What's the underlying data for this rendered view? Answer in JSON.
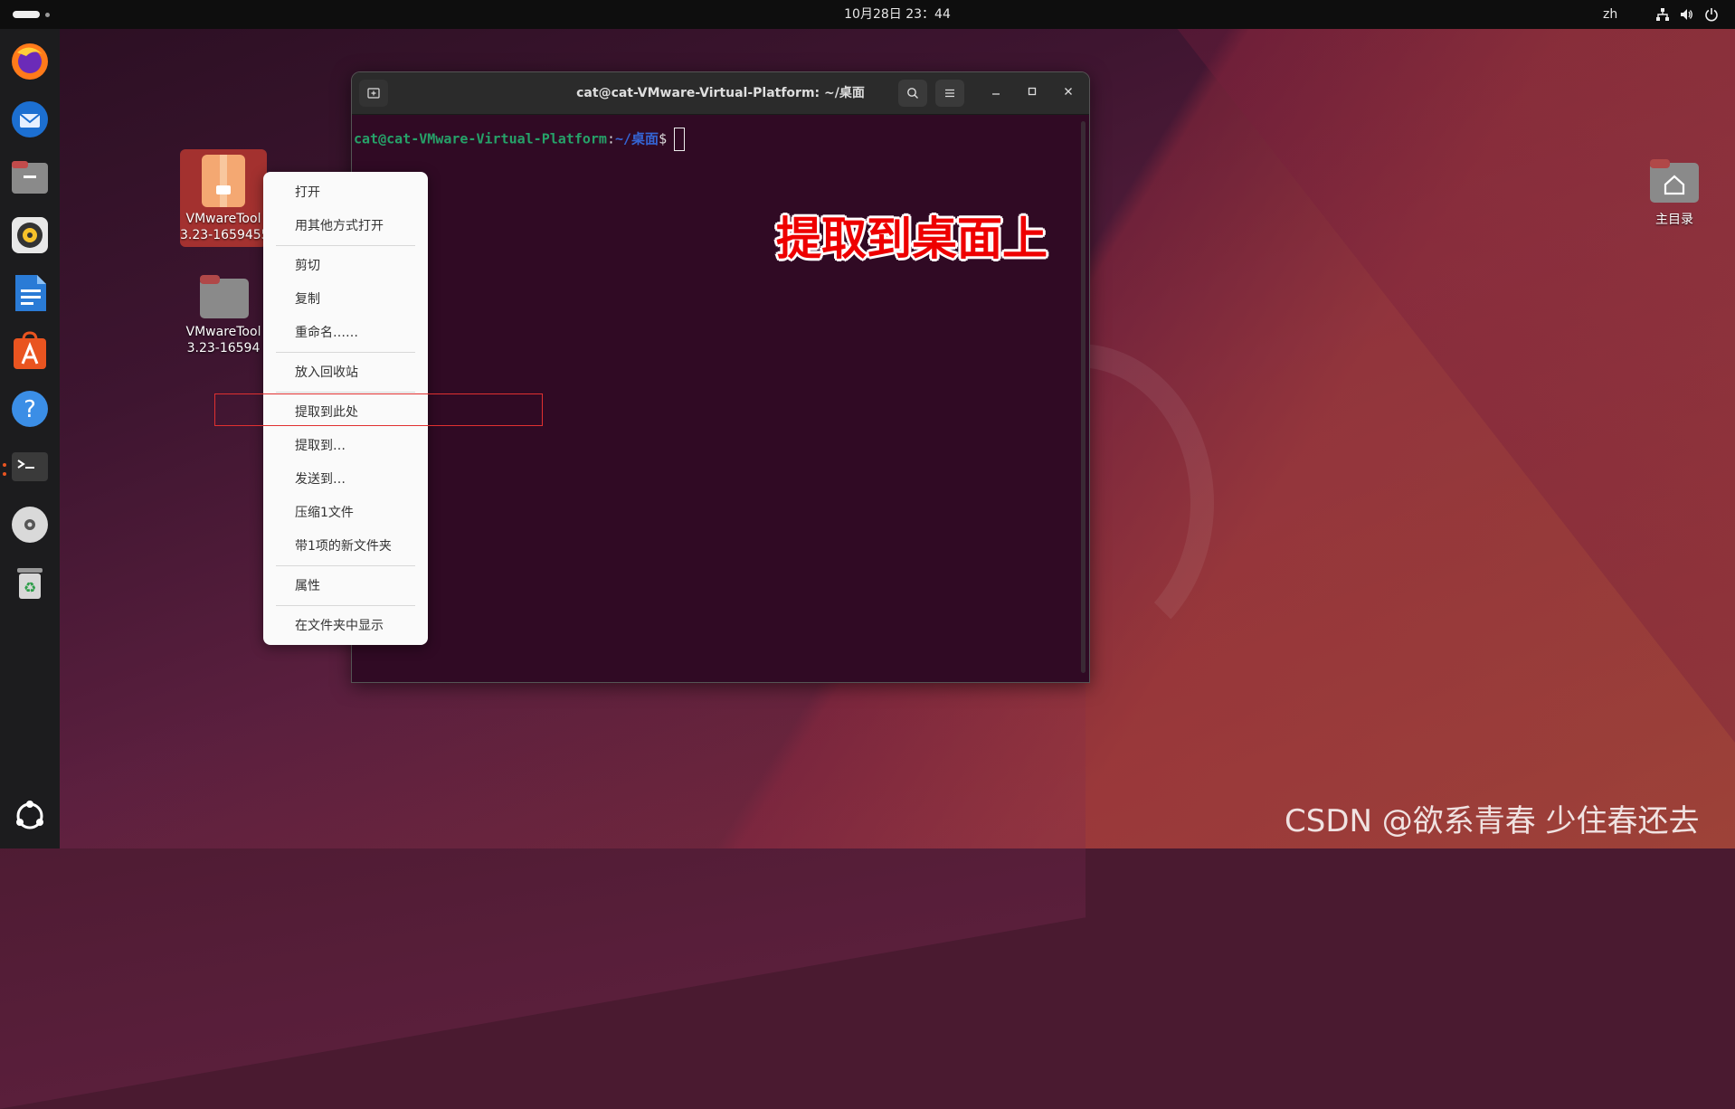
{
  "top_bar": {
    "clock": "10月28日  23：44",
    "language": "zh"
  },
  "dock": {
    "items": [
      "firefox-icon",
      "thunderbird-icon",
      "files-icon",
      "rhythmbox-icon",
      "writer-icon",
      "app-center-icon",
      "help-icon",
      "terminal-icon",
      "dvd-icon",
      "trash-icon",
      "show-apps-icon"
    ]
  },
  "desktop": {
    "icons": [
      {
        "label_line1": "VMwareTool",
        "label_line2": "3.23-1659455"
      },
      {
        "label_line1": "VMwareTool",
        "label_line2": "3.23-16594"
      },
      {
        "label": "主目录"
      }
    ]
  },
  "terminal": {
    "title": "cat@cat-VMware-Virtual-Platform: ~/桌面",
    "prompt_user": "cat@cat-VMware-Virtual-Platform",
    "prompt_colon": ":",
    "prompt_path": "~/桌面",
    "prompt_dollar": "$"
  },
  "context_menu": {
    "items": [
      "打开",
      "用其他方式打开",
      "剪切",
      "复制",
      "重命名……",
      "放入回收站",
      "提取到此处",
      "提取到…",
      "发送到…",
      "压缩1文件",
      "带1项的新文件夹",
      "属性",
      "在文件夹中显示"
    ]
  },
  "annotation": "提取到桌面上",
  "watermark": "CSDN @欲系青春 少住春还去",
  "colors": {
    "ubuntu_orange": "#e95420",
    "annotation_red": "#ee0000",
    "terminal_bg": "#300a24"
  }
}
